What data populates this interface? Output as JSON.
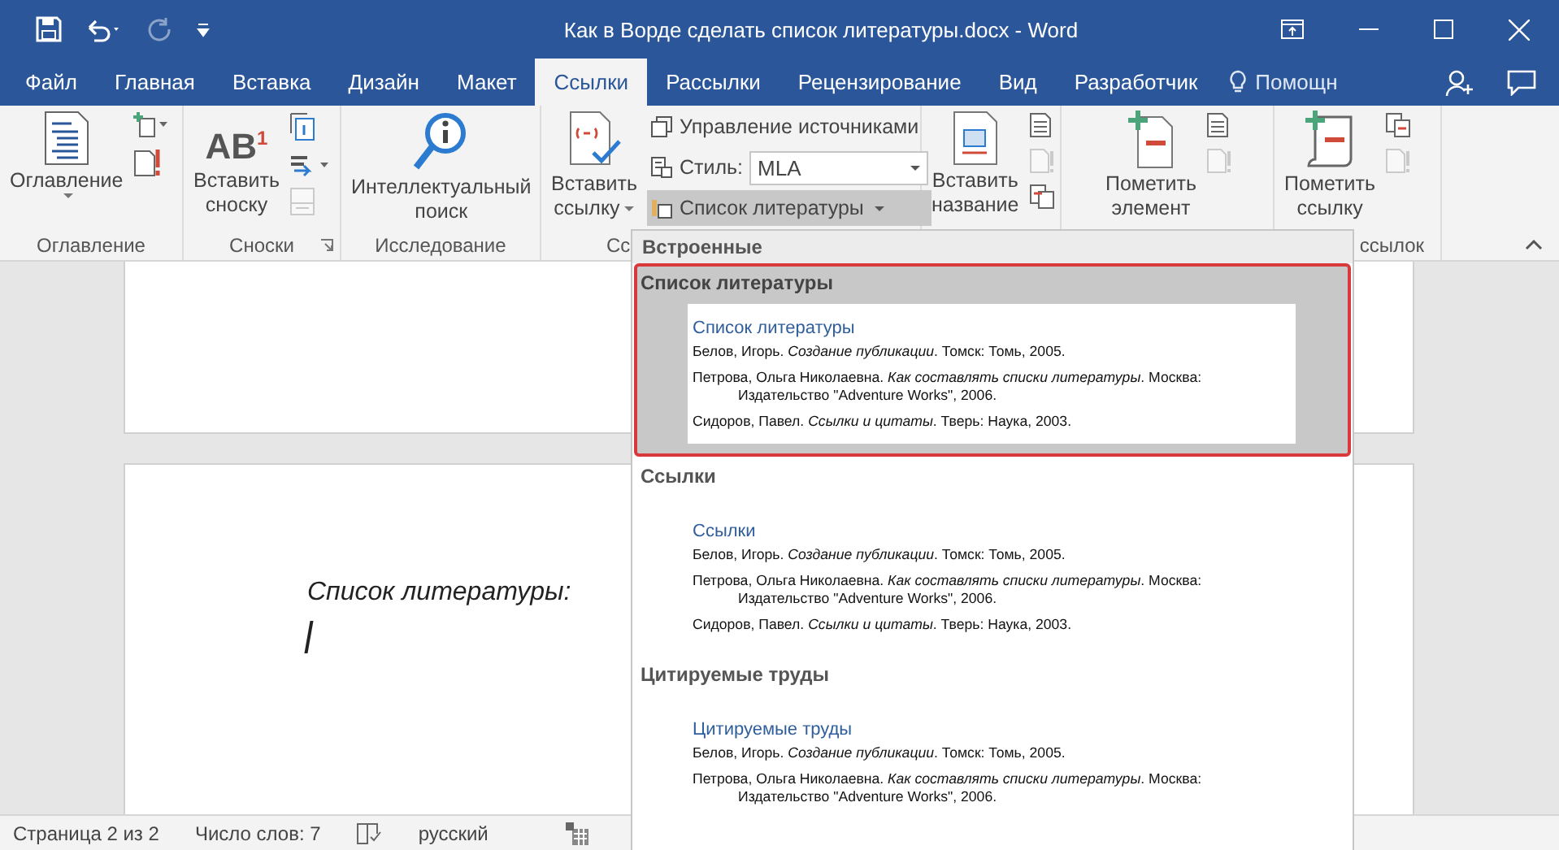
{
  "title_bar": {
    "title": "Как в Ворде сделать список литературы.docx - Word",
    "quick_access": [
      {
        "kind": "save",
        "disabled": false
      },
      {
        "kind": "undo",
        "disabled": false
      },
      {
        "kind": "redo",
        "disabled": true
      },
      {
        "kind": "customize",
        "disabled": false
      }
    ]
  },
  "tabs": [
    {
      "label": "Файл",
      "selected": false
    },
    {
      "label": "Главная",
      "selected": false
    },
    {
      "label": "Вставка",
      "selected": false
    },
    {
      "label": "Дизайн",
      "selected": false
    },
    {
      "label": "Макет",
      "selected": false
    },
    {
      "label": "Ссылки",
      "selected": true
    },
    {
      "label": "Рассылки",
      "selected": false
    },
    {
      "label": "Рецензирование",
      "selected": false
    },
    {
      "label": "Вид",
      "selected": false
    },
    {
      "label": "Разработчик",
      "selected": false
    }
  ],
  "tell_me": {
    "label": "Помощн"
  },
  "ribbon": {
    "groups": [
      {
        "kind": "toc",
        "label": "Оглавление",
        "large": {
          "label": "Оглавление",
          "dropdown": true
        }
      },
      {
        "kind": "footnotes",
        "label": "Сноски",
        "large": {
          "label": "Вставить сноску",
          "icon_text": "AB$^{1}$"
        }
      },
      {
        "kind": "research",
        "label": "Исследование",
        "large": {
          "label": "Интеллектуальный поиск"
        }
      },
      {
        "kind": "citations",
        "label": "Сс",
        "large": {
          "label": "Вставить ссылку",
          "dropdown": true
        },
        "manage": "Управление источниками",
        "style_label": "Стиль:",
        "style_value": "MLA",
        "bibliography": {
          "label": "Список литературы",
          "active": true
        }
      },
      {
        "kind": "captions",
        "large": {
          "label": "Вставить название"
        }
      },
      {
        "kind": "index",
        "large": {
          "label": "Пометить элемент"
        }
      },
      {
        "kind": "authorities",
        "label": "ссылок",
        "large": {
          "label": "Пометить ссылку"
        }
      }
    ]
  },
  "document": {
    "heading": "Список литературы:"
  },
  "bibliography_menu": {
    "header": "Встроенные",
    "items": [
      {
        "title": "Список литературы",
        "selected": true,
        "preview": {
          "heading": "Список литературы",
          "entries": [
            "Белов, Игорь. *Создание публикации*. Томск: Томь, 2005.",
            "Петрова, Ольга Николаевна. *Как составлять списки литературы*. Москва: Издательство \"Adventure Works\", 2006.",
            "Сидоров, Павел. *Ссылки и цитаты*. Тверь: Наука, 2003."
          ]
        }
      },
      {
        "title": "Ссылки",
        "selected": false,
        "preview": {
          "heading": "Ссылки",
          "entries": [
            "Белов, Игорь. *Создание публикации*. Томск: Томь, 2005.",
            "Петрова, Ольга Николаевна. *Как составлять списки литературы*. Москва: Издательство \"Adventure Works\", 2006.",
            "Сидоров, Павел. *Ссылки и цитаты*. Тверь: Наука, 2003."
          ]
        }
      },
      {
        "title": "Цитируемые труды",
        "selected": false,
        "preview": {
          "heading": "Цитируемые труды",
          "entries": [
            "Белов, Игорь. *Создание публикации*. Томск: Томь, 2005.",
            "Петрова, Ольга Николаевна. *Как составлять списки литературы*. Москва: Издательство \"Adventure Works\", 2006."
          ]
        }
      }
    ]
  },
  "status_bar": {
    "page": "Страница 2 из 2",
    "words": "Число слов: 7",
    "language": "русский"
  }
}
